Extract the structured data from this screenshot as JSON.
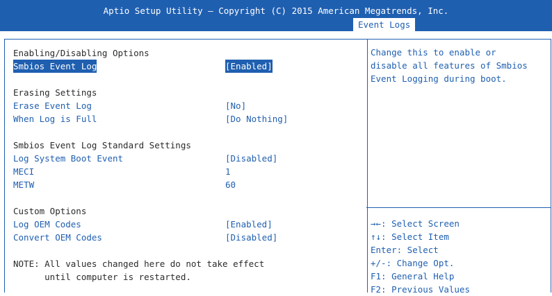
{
  "header": {
    "title": "Aptio Setup Utility – Copyright (C) 2015 American Megatrends, Inc.",
    "tab": "Event Logs"
  },
  "main": {
    "sections": {
      "enabling": "Enabling/Disabling Options",
      "erasing": "Erasing Settings",
      "standard": "Smbios Event Log Standard Settings",
      "custom": "Custom Options"
    },
    "items": {
      "smbios_event_log": {
        "label": "Smbios Event Log",
        "value": "[Enabled]"
      },
      "erase_event_log": {
        "label": "Erase Event Log",
        "value": "[No]"
      },
      "when_log_full": {
        "label": "When Log is Full",
        "value": "[Do Nothing]"
      },
      "log_system_boot": {
        "label": "Log System Boot Event",
        "value": "[Disabled]"
      },
      "meci": {
        "label": "MECI",
        "value": "1"
      },
      "metw": {
        "label": "METW",
        "value": "60"
      },
      "log_oem_codes": {
        "label": "Log OEM Codes",
        "value": "[Enabled]"
      },
      "convert_oem_codes": {
        "label": "Convert OEM Codes",
        "value": "[Disabled]"
      }
    },
    "note_line1": "NOTE: All values changed here do not take effect",
    "note_line2": "      until computer is restarted."
  },
  "help": {
    "description_lines": [
      "Change this to enable or",
      "disable all features of Smbios",
      "Event Logging during boot."
    ],
    "keys": [
      "→←: Select Screen",
      "↑↓: Select Item",
      "Enter: Select",
      "+/-: Change Opt.",
      "F1: General Help",
      "F2: Previous Values"
    ]
  },
  "colors": {
    "accent": "#1f5fb0",
    "text": "#2b2b2b",
    "background": "#ffffff"
  }
}
